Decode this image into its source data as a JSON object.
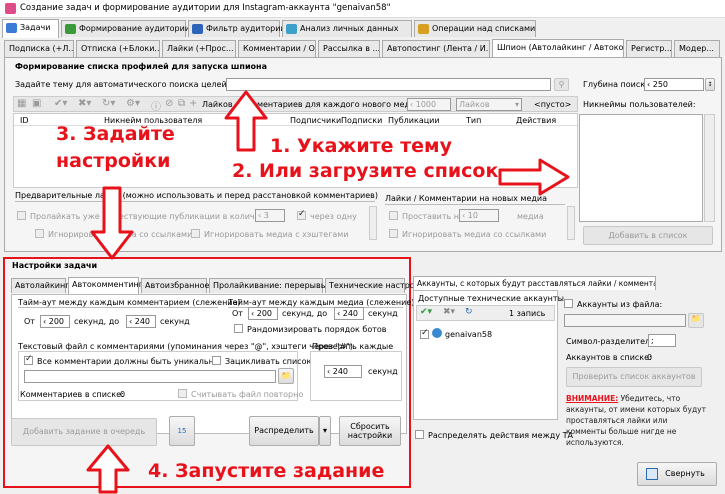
{
  "window": {
    "title": "Создание задач и формирование аудитории для Instagram-аккаунта \"genaivan58\""
  },
  "main_tabs": [
    {
      "label": "Задачи",
      "color": "#3a7bd5"
    },
    {
      "label": "Формирование аудитории",
      "color": "#3a9a3a"
    },
    {
      "label": "Фильтр аудитории",
      "color": "#2c62b8"
    },
    {
      "label": "Анализ личных данных",
      "color": "#3ca0c8"
    },
    {
      "label": "Операции над списками",
      "color": "#d8a020"
    }
  ],
  "sub_tabs": [
    "Подписка (+Л...",
    "Отписка (+Блоки...",
    "Лайки (+Прос...",
    "Комментарии / О...",
    "Рассылка в ...",
    "Автопостинг (Лента / И...",
    "Шпион (Автолайкинг / Автоком...",
    "Регистр...",
    "Модер..."
  ],
  "spy": {
    "section_title": "Формирование списка профилей для запуска шпиона",
    "theme_label": "Задайте тему для автоматического поиска целей:",
    "theme_value": "",
    "depth_label": "Глубина поиска:",
    "depth_value": "250",
    "per_media_label": "Лайков / Комментариев для каждого нового медиа:",
    "per_media_value": "1000",
    "per_media_type": "Лайков",
    "empty_label": "<пусто>",
    "nicknames_label": "Никнеймы пользователей:",
    "columns": [
      "ID",
      "Никнейм пользователя",
      "Подписчики",
      "Подписки",
      "Публикации",
      "Тип",
      "Действия"
    ],
    "add_to_list": "Добавить в список"
  },
  "preliminary": {
    "title": "Предварительные лайки (можно использовать и перед расстановкой комментариев)",
    "like_existing": "Пролайкать уже существующие публикации в количестве",
    "like_count": "3",
    "after_one": "через одну",
    "ignore_links": "Игнорировать медиа со ссылками",
    "ignore_hashtags": "Игнорировать медиа с хэштегами"
  },
  "new_media": {
    "title": "Лайки / Комментарии на новых медиа",
    "place_on": "Проставить на",
    "count": "10",
    "media": "медиа",
    "ignore_links": "Игнорировать медиа со ссылками"
  },
  "task": {
    "title": "Настройки задачи",
    "tabs": [
      "Автолайкинг",
      "Автокомментинг",
      "Автоизбранное",
      "Пролайкивание: перерывы",
      "Технические настройки"
    ],
    "timeout_comments": "Тайм-аут между каждым комментарием (слежение)",
    "timeout_media": "Тайм-аут между каждым медиа (слежение)",
    "from": "От",
    "sec_to": "секунд, до",
    "sec": "секунд",
    "c_from": "200",
    "c_to": "240",
    "m_from": "200",
    "m_to": "240",
    "randomize": "Рандомизировать порядок ботов",
    "comment_file_label": "Текстовый файл с комментариями (упоминания через \"@\", хэштеги через \"#\")",
    "unique": "Все комментарии должны быть уникальны",
    "loop": "Зацикливать список",
    "in_list": "Комментариев в списке:",
    "in_list_count": "0",
    "reread": "Считывать файл повторно",
    "check_each": "Проверять каждые",
    "check_value": "240",
    "add_queue": "Добавить задание в очередь",
    "distribute": "Распределить",
    "reset": "Сбросить настройки"
  },
  "accounts": {
    "tab": "Аккаунты, с которых будут расставляться лайки / комментарии",
    "available": "Доступные технические аккаунты",
    "records": "1 запись",
    "account_name": "genaivan58",
    "from_file": "Аккаунты из файла:",
    "separator": "Символ-разделитель:",
    "separator_value": ";",
    "in_list": "Аккаунтов в списке:",
    "in_list_count": "0",
    "check_list": "Проверить список аккаунтов",
    "warning_title": "ВНИМАНИЕ:",
    "warning_text": "Убедитесь, что аккаунты, от имени которых будут проставляться лайки или комменты больше нигде не используются.",
    "distribute_ta": "Распределять действия между ТА"
  },
  "collapse": "Свернуть",
  "annotations": {
    "step1": "1. Укажите тему",
    "step2": "2. Или загрузите список",
    "step3": "3. Задайте настройки",
    "step4": "4. Запустите задание",
    "red": "#e8121b"
  }
}
